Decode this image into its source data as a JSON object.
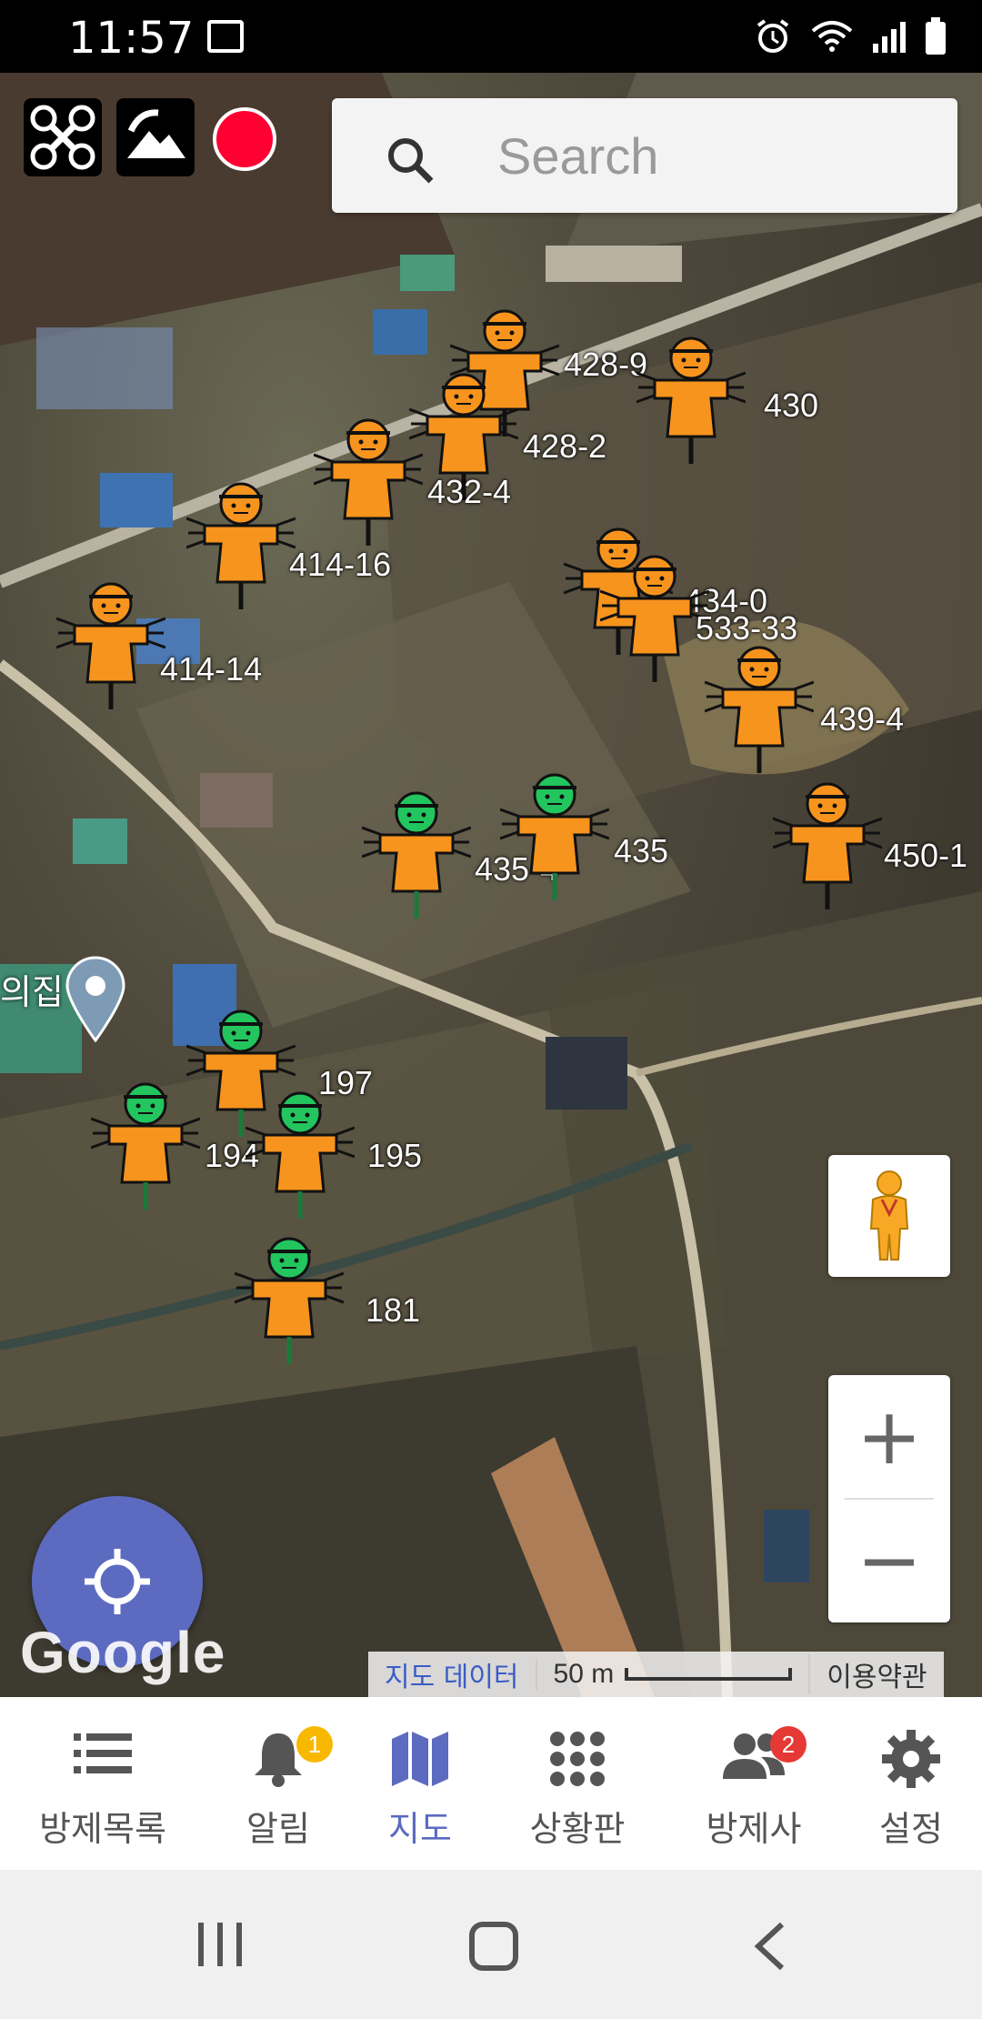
{
  "status_bar": {
    "time": "11:57"
  },
  "toolbar": {
    "drone_button": "drone-icon",
    "gallery_button": "gallery-icon",
    "record_color": "#ff0033"
  },
  "search": {
    "placeholder": "Search"
  },
  "markers": [
    {
      "label": "428-9",
      "color": "orange"
    },
    {
      "label": "430",
      "color": "orange"
    },
    {
      "label": "428-2",
      "color": "orange"
    },
    {
      "label": "432-4",
      "color": "orange"
    },
    {
      "label": "414-16",
      "color": "orange"
    },
    {
      "label": "434-0",
      "color": "orange"
    },
    {
      "label": "533-33",
      "color": "orange"
    },
    {
      "label": "414-14",
      "color": "orange"
    },
    {
      "label": "439-4",
      "color": "orange"
    },
    {
      "label": "435-4",
      "color": "green"
    },
    {
      "label": "435",
      "color": "green"
    },
    {
      "label": "450-1",
      "color": "orange"
    },
    {
      "label": "197",
      "color": "green"
    },
    {
      "label": "194",
      "color": "green"
    },
    {
      "label": "195",
      "color": "green"
    },
    {
      "label": "181",
      "color": "green"
    }
  ],
  "place_label": "의집",
  "map_controls": {
    "zoom_in": "+",
    "zoom_out": "−"
  },
  "google_logo": "Google",
  "attribution": {
    "map_data": "지도 데이터",
    "scale": "50 m",
    "terms": "이용약관"
  },
  "bottom_nav": [
    {
      "label": "방제목록",
      "icon": "list-icon",
      "active": false
    },
    {
      "label": "알림",
      "icon": "bell-icon",
      "badge": "1",
      "active": false
    },
    {
      "label": "지도",
      "icon": "map-icon",
      "active": true
    },
    {
      "label": "상황판",
      "icon": "grid-icon",
      "active": false
    },
    {
      "label": "방제사",
      "icon": "people-icon",
      "badge": "2",
      "active": false
    },
    {
      "label": "설정",
      "icon": "gear-icon",
      "active": false
    }
  ],
  "colors": {
    "accent": "#5c6bc0",
    "badge_yellow": "#f9b800",
    "badge_red": "#e53935",
    "marker_orange": "#f7941d",
    "marker_green": "#22c55e"
  }
}
